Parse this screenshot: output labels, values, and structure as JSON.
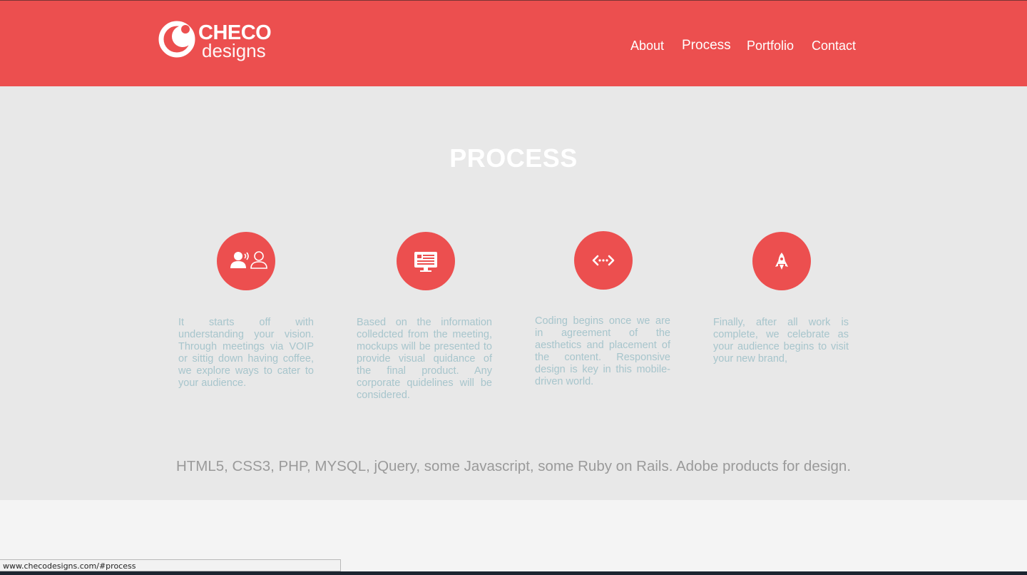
{
  "header": {
    "logo": {
      "top": "CHECO",
      "bottom": "designs"
    },
    "nav": [
      {
        "label": "About"
      },
      {
        "label": "Process",
        "active": true
      },
      {
        "label": "Portfolio"
      },
      {
        "label": "Contact"
      }
    ]
  },
  "process": {
    "title": "PROCESS",
    "steps": [
      {
        "icon": "users-talking-icon",
        "text": "It starts off with understanding your vision. Through meetings via VOIP or sittig down having coffee, we explore ways to cater to your audience."
      },
      {
        "icon": "monitor-icon",
        "text": "Based on the information colledcted from the meeting, mockups will be presented to provide visual quidance of the final product. Any corporate quidelines will be considered."
      },
      {
        "icon": "code-arrows-icon",
        "text": "Coding begins once we are in agreement of the aesthetics and placement of the content. Responsive design is key in this mobile-driven world."
      },
      {
        "icon": "rocket-icon",
        "text": "Finally, after all work is complete, we celebrate as your audience begins to visit your new brand,"
      }
    ],
    "tech": "HTML5, CSS3, PHP, MYSQL, jQuery, some Javascript, some Ruby on Rails. Adobe products for design."
  },
  "statusbar": {
    "url": "www.checodesigns.com/#process"
  },
  "colors": {
    "accent": "#ec4f4f",
    "section_bg": "#e8e8e8",
    "step_text": "#a7c5cc"
  }
}
